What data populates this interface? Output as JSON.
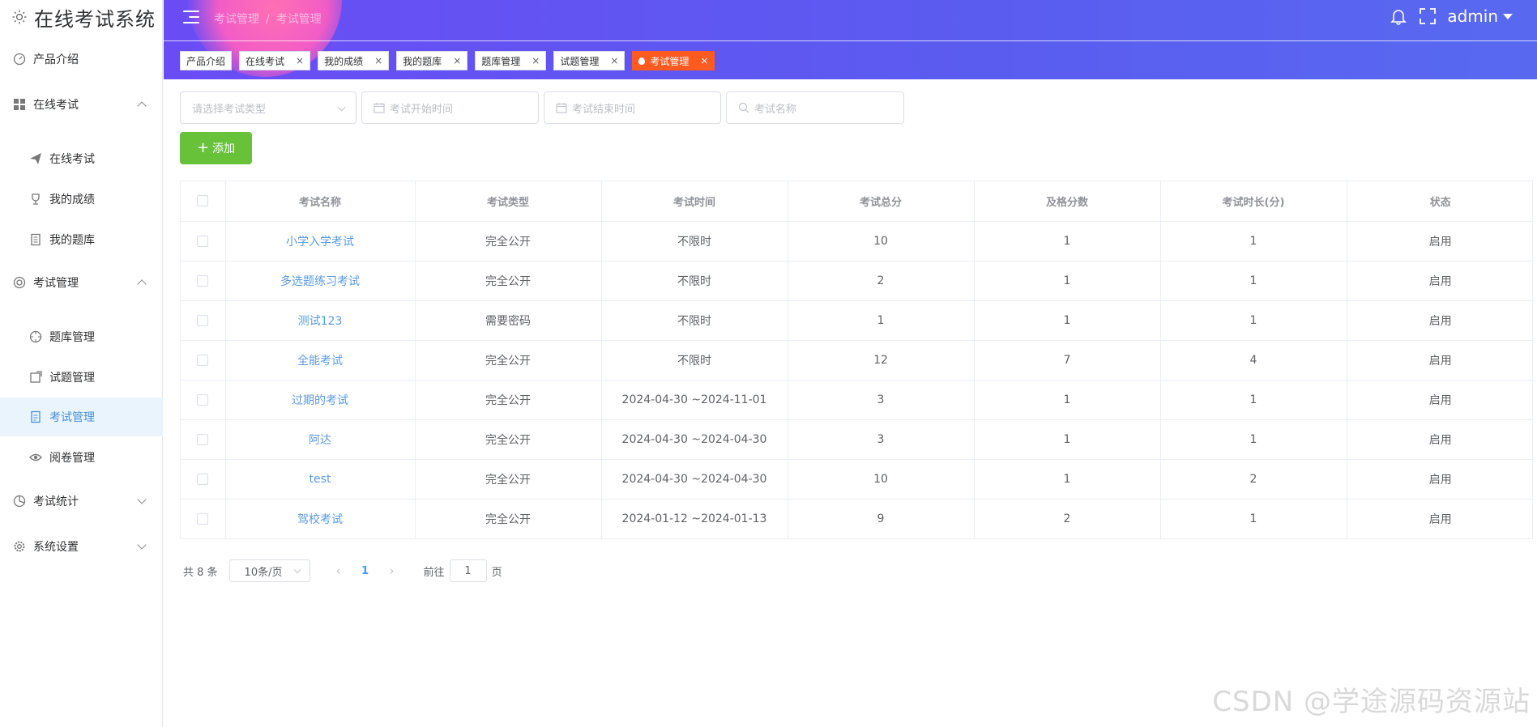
{
  "app": {
    "title": "在线考试系统"
  },
  "sidebar": {
    "items": [
      {
        "label": "产品介绍"
      },
      {
        "label": "在线考试"
      },
      {
        "label": "在线考试"
      },
      {
        "label": "我的成绩"
      },
      {
        "label": "我的题库"
      },
      {
        "label": "考试管理"
      },
      {
        "label": "题库管理"
      },
      {
        "label": "试题管理"
      },
      {
        "label": "考试管理"
      },
      {
        "label": "阅卷管理"
      },
      {
        "label": "考试统计"
      },
      {
        "label": "系统设置"
      }
    ]
  },
  "header": {
    "breadcrumb": [
      "考试管理",
      "考试管理"
    ],
    "breadcrumb_sep": "/",
    "user": "admin"
  },
  "tags": [
    {
      "label": "产品介绍"
    },
    {
      "label": "在线考试",
      "close": "×"
    },
    {
      "label": "我的成绩",
      "close": "×"
    },
    {
      "label": "我的题库",
      "close": "×"
    },
    {
      "label": "题库管理",
      "close": "×"
    },
    {
      "label": "试题管理",
      "close": "×"
    },
    {
      "label": "考试管理",
      "close": "×"
    }
  ],
  "filters": {
    "type_placeholder": "请选择考试类型",
    "start_placeholder": "考试开始时间",
    "end_placeholder": "考试结束时间",
    "name_placeholder": "考试名称"
  },
  "toolbar": {
    "add_label": "添加",
    "add_icon": "+"
  },
  "table": {
    "headers": [
      "考试名称",
      "考试类型",
      "考试时间",
      "考试总分",
      "及格分数",
      "考试时长(分)",
      "状态"
    ],
    "rows": [
      [
        "小学入学考试",
        "完全公开",
        "不限时",
        "10",
        "1",
        "1",
        "启用"
      ],
      [
        "多选题练习考试",
        "完全公开",
        "不限时",
        "2",
        "1",
        "1",
        "启用"
      ],
      [
        "测试123",
        "需要密码",
        "不限时",
        "1",
        "1",
        "1",
        "启用"
      ],
      [
        "全能考试",
        "完全公开",
        "不限时",
        "12",
        "7",
        "4",
        "启用"
      ],
      [
        "过期的考试",
        "完全公开",
        "2024-04-30 ~2024-11-01",
        "3",
        "1",
        "1",
        "启用"
      ],
      [
        "阿达",
        "完全公开",
        "2024-04-30 ~2024-04-30",
        "3",
        "1",
        "1",
        "启用"
      ],
      [
        "test",
        "完全公开",
        "2024-04-30 ~2024-04-30",
        "10",
        "1",
        "2",
        "启用"
      ],
      [
        "驾校考试",
        "完全公开",
        "2024-01-12 ~2024-01-13",
        "9",
        "2",
        "1",
        "启用"
      ]
    ]
  },
  "pagination": {
    "total_text": "共 8 条",
    "page_size": "10条/页",
    "prev": "‹",
    "current": "1",
    "next": "›",
    "goto_prefix": "前往",
    "goto_value": "1",
    "goto_suffix": "页"
  },
  "watermark": "CSDN @学途源码资源站"
}
